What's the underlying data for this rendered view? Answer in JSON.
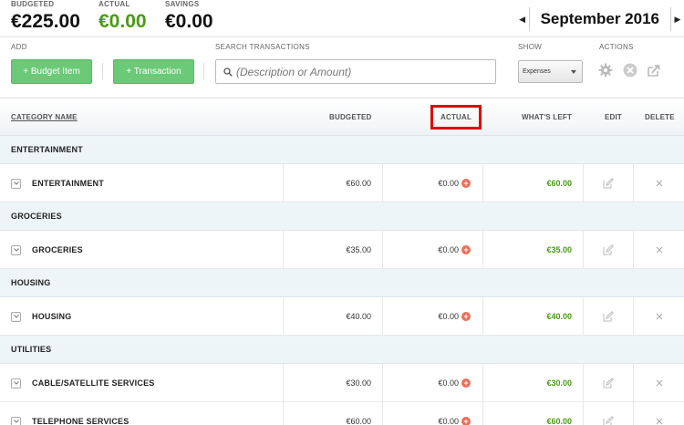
{
  "summary": {
    "budgeted_label": "BUDGETED",
    "budgeted_value": "€225.00",
    "actual_label": "ACTUAL",
    "actual_value": "€0.00",
    "savings_label": "SAVINGS",
    "savings_value": "€0.00"
  },
  "month": {
    "label": "September 2016"
  },
  "toolbar": {
    "add_label": "ADD",
    "budget_item_button": "+ Budget Item",
    "transaction_button": "+ Transaction",
    "search_label": "SEARCH TRANSACTIONS",
    "search_placeholder": "(Description or Amount)",
    "show_label": "SHOW",
    "show_selected": "Expenses",
    "actions_label": "ACTIONS"
  },
  "table": {
    "headers": {
      "category": "CATEGORY NAME",
      "budgeted": "BUDGETED",
      "actual": "ACTUAL",
      "left": "WHAT'S LEFT",
      "edit": "EDIT",
      "delete": "DELETE"
    },
    "groups": [
      {
        "name": "ENTERTAINMENT",
        "items": [
          {
            "name": "ENTERTAINMENT",
            "budgeted": "€60.00",
            "actual": "€0.00",
            "left": "€60.00"
          }
        ]
      },
      {
        "name": "GROCERIES",
        "items": [
          {
            "name": "GROCERIES",
            "budgeted": "€35.00",
            "actual": "€0.00",
            "left": "€35.00"
          }
        ]
      },
      {
        "name": "HOUSING",
        "items": [
          {
            "name": "HOUSING",
            "budgeted": "€40.00",
            "actual": "€0.00",
            "left": "€40.00"
          }
        ]
      },
      {
        "name": "UTILITIES",
        "items": [
          {
            "name": "CABLE/SATELLITE SERVICES",
            "budgeted": "€30.00",
            "actual": "€0.00",
            "left": "€30.00"
          },
          {
            "name": "TELEPHONE SERVICES",
            "budgeted": "€60.00",
            "actual": "€0.00",
            "left": "€60.00"
          }
        ]
      }
    ]
  },
  "colors": {
    "accent_green": "#6bc977",
    "positive_text": "#4a9a14",
    "highlight_red": "#e00000"
  }
}
